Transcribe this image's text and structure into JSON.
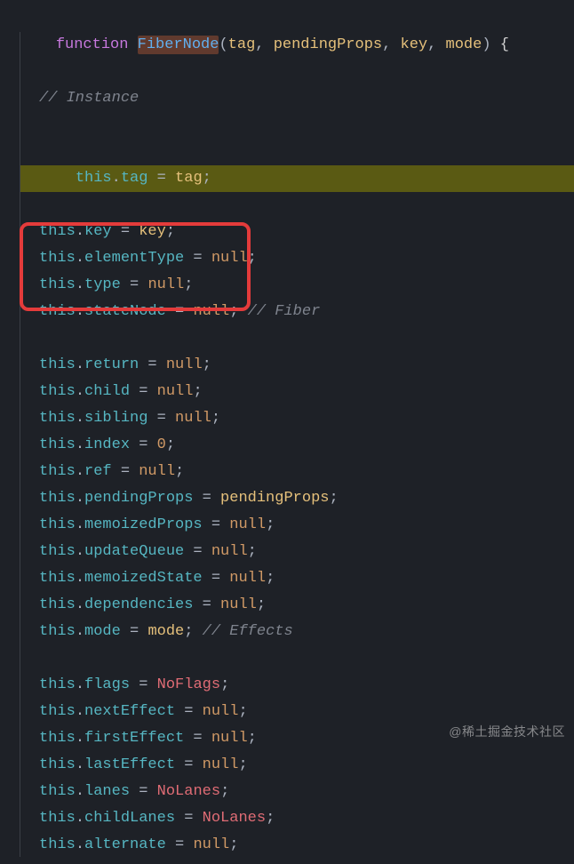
{
  "fn": {
    "keyword": "function",
    "name": "FiberNode",
    "params": [
      "tag",
      "pendingProps",
      "key",
      "mode"
    ]
  },
  "comments": {
    "instance": "// Instance",
    "fiber": "// Fiber",
    "effects": "// Effects"
  },
  "lines": {
    "tag": {
      "prop": "tag",
      "value_kind": "param",
      "value": "tag"
    },
    "key": {
      "prop": "key",
      "value_kind": "param",
      "value": "key"
    },
    "elementType": {
      "prop": "elementType",
      "value_kind": "null",
      "value": "null"
    },
    "type": {
      "prop": "type",
      "value_kind": "null",
      "value": "null"
    },
    "stateNode": {
      "prop": "stateNode",
      "value_kind": "null",
      "value": "null"
    },
    "return": {
      "prop": "return",
      "value_kind": "null",
      "value": "null"
    },
    "child": {
      "prop": "child",
      "value_kind": "null",
      "value": "null"
    },
    "sibling": {
      "prop": "sibling",
      "value_kind": "null",
      "value": "null"
    },
    "index": {
      "prop": "index",
      "value_kind": "num",
      "value": "0"
    },
    "ref": {
      "prop": "ref",
      "value_kind": "null",
      "value": "null"
    },
    "pendingProps": {
      "prop": "pendingProps",
      "value_kind": "param",
      "value": "pendingProps"
    },
    "memoizedProps": {
      "prop": "memoizedProps",
      "value_kind": "null",
      "value": "null"
    },
    "updateQueue": {
      "prop": "updateQueue",
      "value_kind": "null",
      "value": "null"
    },
    "memoizedState": {
      "prop": "memoizedState",
      "value_kind": "null",
      "value": "null"
    },
    "dependencies": {
      "prop": "dependencies",
      "value_kind": "null",
      "value": "null"
    },
    "mode": {
      "prop": "mode",
      "value_kind": "param",
      "value": "mode"
    },
    "flags": {
      "prop": "flags",
      "value_kind": "ident",
      "value": "NoFlags"
    },
    "nextEffect": {
      "prop": "nextEffect",
      "value_kind": "null",
      "value": "null"
    },
    "firstEffect": {
      "prop": "firstEffect",
      "value_kind": "null",
      "value": "null"
    },
    "lastEffect": {
      "prop": "lastEffect",
      "value_kind": "null",
      "value": "null"
    },
    "lanes": {
      "prop": "lanes",
      "value_kind": "ident",
      "value": "NoLanes"
    },
    "childLanes": {
      "prop": "childLanes",
      "value_kind": "ident",
      "value": "NoLanes"
    },
    "alternate": {
      "prop": "alternate",
      "value_kind": "null",
      "value": "null"
    }
  },
  "tokens": {
    "this": "this",
    "dot": ".",
    "eq": " = ",
    "semi": ";",
    "comma": ", ",
    "lparen": "(",
    "rparen": ")",
    "lbrace": "{",
    "space": " "
  },
  "watermark": "@稀土掘金技术社区"
}
